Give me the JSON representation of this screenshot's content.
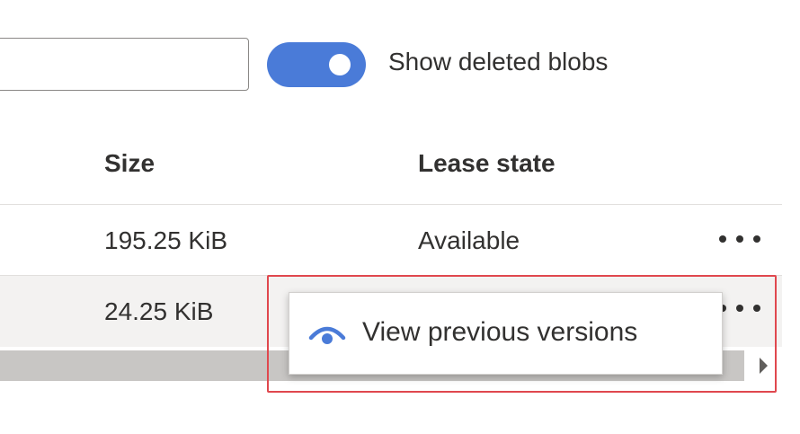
{
  "filter": {
    "search_value": "",
    "show_deleted_label": "Show deleted blobs",
    "show_deleted_on": true
  },
  "table": {
    "columns": [
      "Size",
      "Lease state"
    ],
    "rows": [
      {
        "size": "195.25 KiB",
        "lease_state": "Available"
      },
      {
        "size": "24.25 KiB",
        "lease_state": ""
      }
    ]
  },
  "context_menu": {
    "items": [
      {
        "label": "View previous versions",
        "icon": "eye-icon"
      }
    ]
  },
  "colors": {
    "accent": "#4a7bd8",
    "highlight": "#e0484e",
    "selected_row": "#f3f2f1"
  }
}
